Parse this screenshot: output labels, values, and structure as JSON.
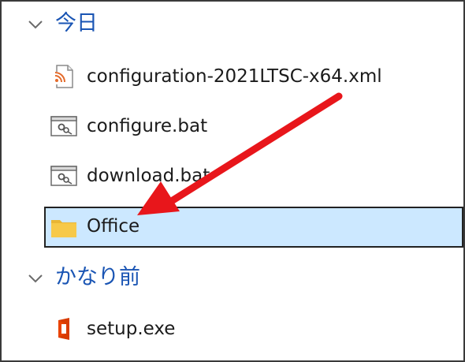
{
  "groups": [
    {
      "label": "今日",
      "items": [
        {
          "name": "configuration-2021LTSC-x64.xml",
          "icon": "xml-file-icon"
        },
        {
          "name": "configure.bat",
          "icon": "batch-file-icon"
        },
        {
          "name": "download.bat",
          "icon": "batch-file-icon"
        },
        {
          "name": "Office",
          "icon": "folder-icon",
          "selected": true
        }
      ]
    },
    {
      "label": "かなり前",
      "items": [
        {
          "name": "setup.exe",
          "icon": "office-setup-icon"
        }
      ]
    }
  ],
  "colors": {
    "group_label": "#1a55b4",
    "selection_bg": "#cce8ff",
    "annotation_arrow": "#e8161b",
    "folder": "#f7c948"
  }
}
